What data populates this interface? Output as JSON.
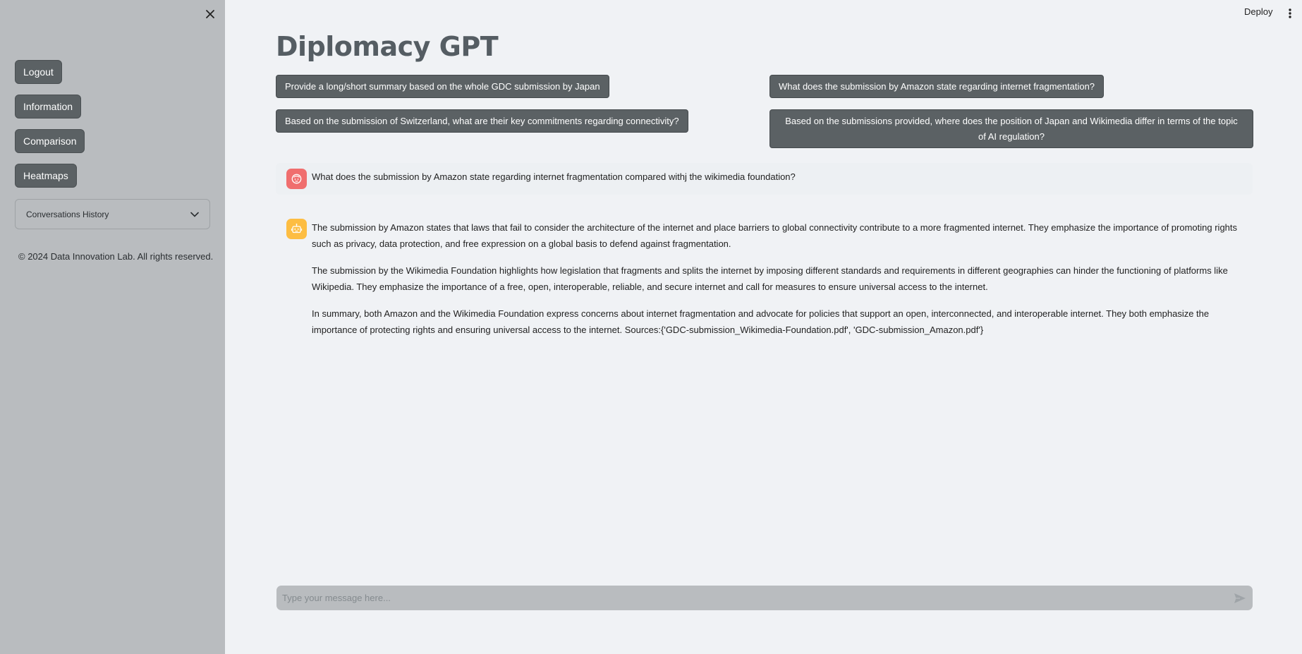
{
  "sidebar": {
    "nav": [
      {
        "label": "Logout"
      },
      {
        "label": "Information"
      },
      {
        "label": "Comparison"
      },
      {
        "label": "Heatmaps"
      }
    ],
    "history_label": "Conversations History",
    "copyright": "© 2024 Data Innovation Lab. All rights reserved."
  },
  "header": {
    "deploy_label": "Deploy"
  },
  "main": {
    "title": "Diplomacy GPT",
    "suggestions": [
      "Provide a long/short summary based on the whole GDC submission by Japan",
      "What does the submission by Amazon state regarding internet fragmentation?",
      "Based on the submission of Switzerland, what are their key commitments regarding connectivity?",
      "Based on the submissions provided, where does the position of Japan and Wikimedia differ in terms of the topic of AI regulation?"
    ],
    "user_message": "What does the submission by Amazon state regarding internet fragmentation compared withj the wikimedia foundation?",
    "bot_paragraphs": [
      "The submission by Amazon states that laws that fail to consider the architecture of the internet and place barriers to global connectivity contribute to a more fragmented internet. They emphasize the importance of promoting rights such as privacy, data protection, and free expression on a global basis to defend against fragmentation.",
      "The submission by the Wikimedia Foundation highlights how legislation that fragments and splits the internet by imposing different standards and requirements in different geographies can hinder the functioning of platforms like Wikipedia. They emphasize the importance of a free, open, interoperable, reliable, and secure internet and call for measures to ensure universal access to the internet.",
      "In summary, both Amazon and the Wikimedia Foundation express concerns about internet fragmentation and advocate for policies that support an open, interconnected, and interoperable internet. They both emphasize the importance of protecting rights and ensuring universal access to the internet. Sources:{'GDC-submission_Wikimedia-Foundation.pdf', 'GDC-submission_Amazon.pdf'}"
    ],
    "input_placeholder": "Type your message here..."
  },
  "colors": {
    "sidebar_bg": "#b9bcbf",
    "main_bg": "#f0f2f5",
    "button_bg": "#5b6164",
    "user_avatar": "#f06e6e",
    "bot_avatar": "#fdbd42"
  },
  "icons": {
    "close": "close-icon",
    "chevron": "chevron-down-icon",
    "menu": "kebab-menu-icon",
    "user": "user-avatar-icon",
    "bot": "bot-avatar-icon",
    "send": "send-icon"
  }
}
